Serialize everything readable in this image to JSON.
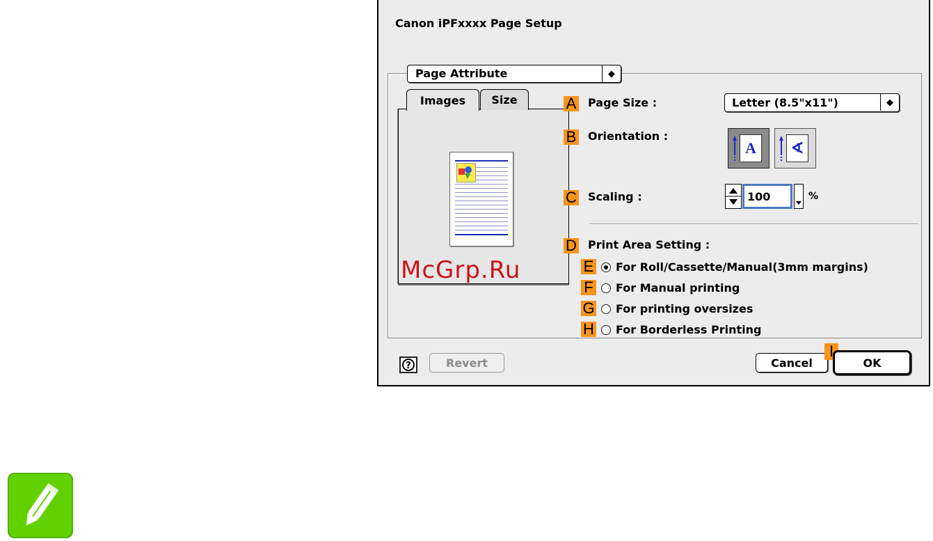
{
  "dialog": {
    "title": "Canon iPFxxxx Page Setup",
    "attribute_popup": "Page Attribute",
    "tabs": [
      {
        "label": "Images",
        "selected": true
      },
      {
        "label": "Size",
        "selected": false
      }
    ],
    "watermark": "McGrp.Ru",
    "fields": {
      "page_size": {
        "badge": "A",
        "label": "Page Size :",
        "value": "Letter (8.5\"x11\")"
      },
      "orientation": {
        "badge": "B",
        "label": "Orientation :",
        "options": [
          {
            "name": "portrait",
            "glyph": "A",
            "selected": true
          },
          {
            "name": "landscape",
            "glyph": "∢",
            "selected": false
          }
        ]
      },
      "scaling": {
        "badge": "C",
        "label": "Scaling :",
        "value": "100",
        "unit": "%"
      },
      "print_area": {
        "badge": "D",
        "label": "Print Area Setting :",
        "options": [
          {
            "badge": "E",
            "label": "For Roll/Cassette/Manual(3mm margins)",
            "checked": true
          },
          {
            "badge": "F",
            "label": "For Manual printing",
            "checked": false
          },
          {
            "badge": "G",
            "label": "For printing oversizes",
            "checked": false
          },
          {
            "badge": "H",
            "label": "For Borderless Printing",
            "checked": false
          }
        ]
      }
    },
    "buttons": {
      "help": "?",
      "revert": "Revert",
      "cancel": "Cancel",
      "ok": "OK",
      "ok_badge": "I"
    }
  },
  "colors": {
    "badge": "#f7941d",
    "watermark": "#c9121b",
    "note_icon": "#62d100",
    "orientation_glyph": "#1d2bc2"
  },
  "icons": [
    "popup-arrows-icon",
    "help-icon",
    "pencil-note-icon",
    "orientation-arrow-icon"
  ]
}
